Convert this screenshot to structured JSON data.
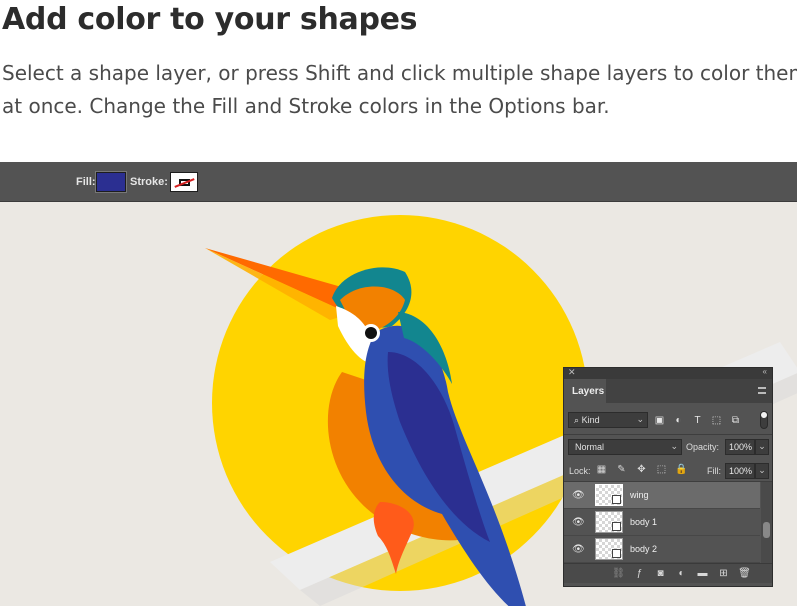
{
  "article": {
    "heading": "Add color to your shapes",
    "line1": "Select a shape layer, or press Shift and click multiple shape layers to color them",
    "line2": "at once. Change the Fill and Stroke colors in the Options bar."
  },
  "options_bar": {
    "fill_label": "Fill:",
    "stroke_label": "Stroke:",
    "fill_color": "#2b2f91"
  },
  "layers_panel": {
    "tab_label": "Layers",
    "filter_kind": "Kind",
    "blend_mode": "Normal",
    "opacity_label": "Opacity:",
    "opacity_value": "100%",
    "lock_label": "Lock:",
    "fill_label": "Fill:",
    "fill_value": "100%",
    "layers": [
      {
        "name": "wing",
        "selected": true
      },
      {
        "name": "body 1",
        "selected": false
      },
      {
        "name": "body 2",
        "selected": false
      }
    ]
  },
  "icons": [
    "eye-icon",
    "search-icon",
    "image-filter-icon",
    "adjustment-filter-icon",
    "type-filter-icon",
    "shape-filter-icon",
    "smart-object-filter-icon",
    "lock-icon",
    "brush-icon",
    "move-icon",
    "artboard-icon",
    "link-icon",
    "fx-icon",
    "mask-icon",
    "new-group-icon",
    "new-layer-icon",
    "trash-icon"
  ],
  "colors": {
    "sun": "#ffd400",
    "background": "#ebe8e3",
    "bird_orange": "#f28100",
    "bird_teal": "#12868f",
    "bird_blue": "#2b2f91"
  }
}
